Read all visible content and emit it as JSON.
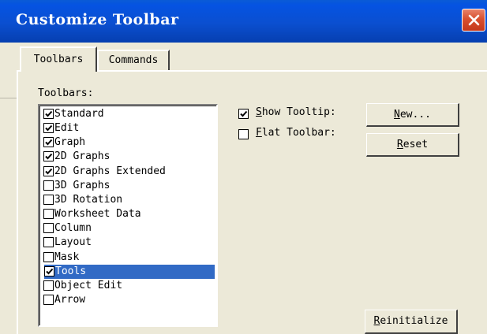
{
  "window": {
    "title": "Customize Toolbar",
    "close_icon": "close-icon"
  },
  "tabs": [
    {
      "label": "Toolbars",
      "active": true
    },
    {
      "label": "Commands",
      "active": false
    }
  ],
  "toolbars_panel": {
    "label": "Toolbars:",
    "items": [
      {
        "label": "Standard",
        "checked": true,
        "selected": false
      },
      {
        "label": "Edit",
        "checked": true,
        "selected": false
      },
      {
        "label": "Graph",
        "checked": true,
        "selected": false
      },
      {
        "label": "2D Graphs",
        "checked": true,
        "selected": false
      },
      {
        "label": "2D Graphs Extended",
        "checked": true,
        "selected": false
      },
      {
        "label": "3D Graphs",
        "checked": false,
        "selected": false
      },
      {
        "label": "3D Rotation",
        "checked": false,
        "selected": false
      },
      {
        "label": "Worksheet Data",
        "checked": false,
        "selected": false
      },
      {
        "label": "Column",
        "checked": false,
        "selected": false
      },
      {
        "label": "Layout",
        "checked": false,
        "selected": false
      },
      {
        "label": "Mask",
        "checked": false,
        "selected": false
      },
      {
        "label": "Tools",
        "checked": true,
        "selected": true
      },
      {
        "label": "Object Edit",
        "checked": false,
        "selected": false
      },
      {
        "label": "Arrow",
        "checked": false,
        "selected": false
      }
    ]
  },
  "options": {
    "show_tooltip": {
      "first": "S",
      "rest": "how Tooltip:",
      "checked": true
    },
    "flat_toolbar": {
      "first": "F",
      "rest": "lat Toolbar:",
      "checked": false
    }
  },
  "buttons": {
    "new": {
      "first": "N",
      "rest": "ew..."
    },
    "reset": {
      "first": "R",
      "rest": "eset"
    },
    "reinitialize": {
      "first": "R",
      "rest": "einitialize"
    }
  },
  "colors": {
    "title_bar": "#0553e2",
    "selection": "#316ac5",
    "dialog_face": "#ece9d8",
    "close_button": "#d8502f"
  }
}
